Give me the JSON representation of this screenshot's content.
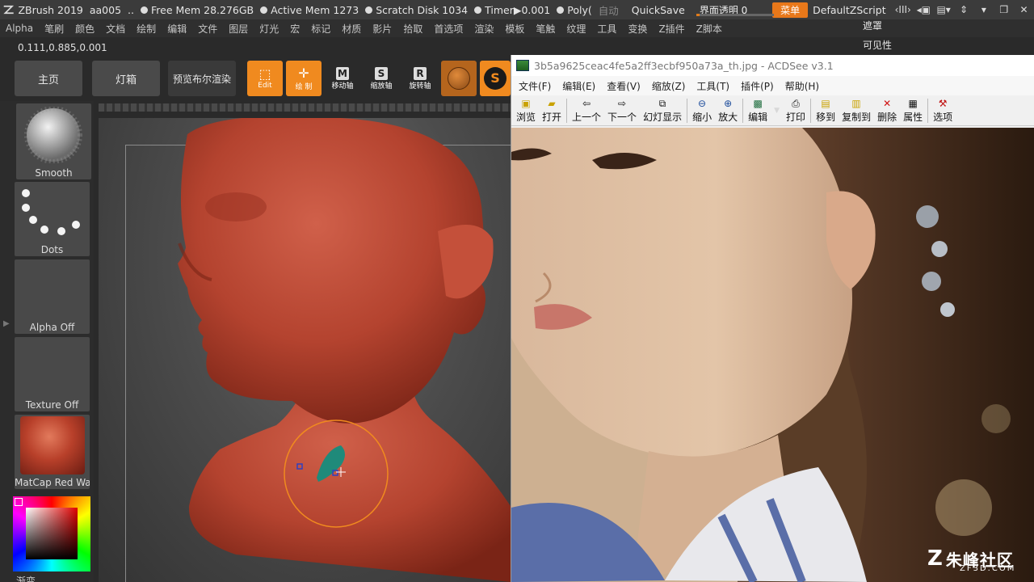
{
  "titlebar": {
    "app": "ZBrush 2019",
    "user": "aa005",
    "ellipsis": "..",
    "free_mem": "Free Mem 28.276GB",
    "active_mem": "Active Mem 1273",
    "scratch": "Scratch Disk 1034",
    "timer": "Timer▶0.001",
    "poly": "Poly(",
    "auto": "自动",
    "quicksave": "QuickSave",
    "transparency_label": "界面透明 0",
    "transparency_value": 0,
    "menu_btn": "菜单",
    "script": "DefaultZScript"
  },
  "menubar": [
    "Alpha",
    "笔刷",
    "颜色",
    "文档",
    "绘制",
    "编辑",
    "文件",
    "图层",
    "灯光",
    "宏",
    "标记",
    "材质",
    "影片",
    "拾取",
    "首选项",
    "渲染",
    "模板",
    "笔触",
    "纹理",
    "工具",
    "变换",
    "Z插件",
    "Z脚本"
  ],
  "right_labels": {
    "mask": "遮罩",
    "visible": "可见性"
  },
  "coords": "0.111,0.885,0.001",
  "shelf": {
    "home": "主页",
    "lightbox": "灯箱",
    "bpr": "预览布尔渲染",
    "edit": "Edit",
    "draw": "绘 制",
    "move": "移动轴",
    "scale": "缩放轴",
    "rotate": "旋转轴"
  },
  "tray": {
    "brush": "Smooth",
    "stroke": "Dots",
    "alpha": "Alpha Off",
    "texture": "Texture Off",
    "material": "MatCap Red Wax",
    "gradient": "渐变"
  },
  "acdsee": {
    "title": "3b5a9625ceac4fe5a2ff3ecbf950a73a_th.jpg - ACDSee v3.1",
    "menu": [
      "文件(F)",
      "编辑(E)",
      "查看(V)",
      "缩放(Z)",
      "工具(T)",
      "插件(P)",
      "帮助(H)"
    ],
    "toolbar": [
      "浏览",
      "打开",
      "上一个",
      "下一个",
      "幻灯显示",
      "缩小",
      "放大",
      "编辑",
      "打印",
      "移到",
      "复制到",
      "删除",
      "属性",
      "选项"
    ]
  },
  "watermark": {
    "main": "朱峰社区",
    "sub": "ZF3D.COM"
  },
  "colors": {
    "accent": "#f08a1f",
    "clay": "#b84a3a"
  }
}
